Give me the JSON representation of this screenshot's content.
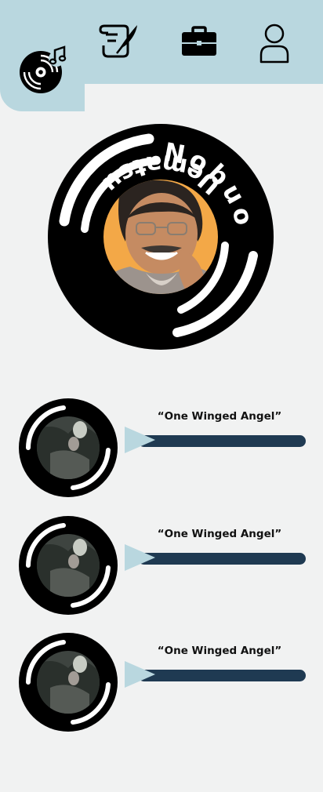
{
  "nav": {
    "items": [
      {
        "icon": "music-disc-icon",
        "active": true
      },
      {
        "icon": "quill-scroll-icon",
        "active": false
      },
      {
        "icon": "briefcase-icon",
        "active": false
      },
      {
        "icon": "user-icon",
        "active": false
      }
    ]
  },
  "artist": {
    "first_name": "Nobuo",
    "last_name": "Uematsu",
    "photo_bg": "#f3a847"
  },
  "tracks": [
    {
      "title": "“One Winged Angel”"
    },
    {
      "title": "“One Winged Angel”"
    },
    {
      "title": "“One Winged Angel”"
    }
  ],
  "colors": {
    "accent": "#b9d7df",
    "bar": "#1f3a52",
    "background": "#f1f2f2",
    "disc": "#000000"
  }
}
